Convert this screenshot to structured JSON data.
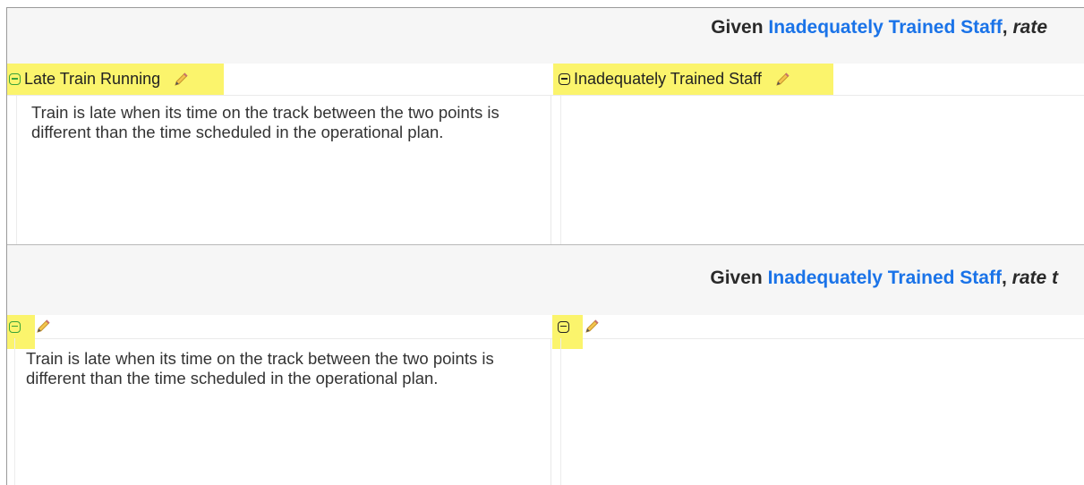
{
  "panels": [
    {
      "question": {
        "prefix": "Given ",
        "link": "Inadequately Trained Staff",
        "suffix": ", ",
        "tail": "rate"
      },
      "left": {
        "title": "Late Train Running",
        "description": "Train is late when its time on the track between the two points is different than the time scheduled in the operational plan."
      },
      "right": {
        "title": "Inadequately Trained Staff",
        "description": ""
      }
    },
    {
      "question": {
        "prefix": "Given ",
        "link": "Inadequately Trained Staff",
        "suffix": ", ",
        "tail": "rate t"
      },
      "left": {
        "title": "",
        "description": "Train is late when its time on the track between the two points is different than the time scheduled in the operational plan."
      },
      "right": {
        "title": "",
        "description": ""
      }
    }
  ],
  "colors": {
    "highlight": "#fbf46c",
    "link": "#1a73e8",
    "toggle_green": "#3aa23a"
  },
  "icons": {
    "collapse": "minus-square-icon",
    "edit": "pencil-icon"
  }
}
